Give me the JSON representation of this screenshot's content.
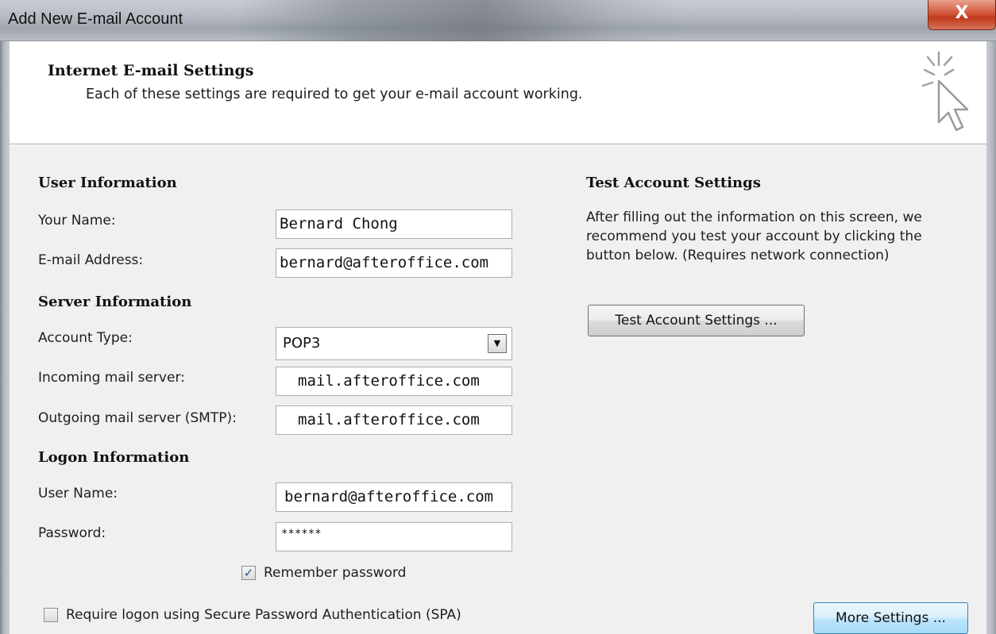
{
  "window": {
    "title": "Add New E-mail Account",
    "close_glyph": "X"
  },
  "header": {
    "title": "Internet E-mail Settings",
    "subtitle": "Each of these settings are required to get your e-mail account working.",
    "icon": "wizard-cursor-icon"
  },
  "user_info": {
    "heading": "User Information",
    "name_label": "Your Name:",
    "name_value": "Bernard Chong",
    "email_label": "E-mail Address:",
    "email_value": "bernard@afteroffice.com"
  },
  "server_info": {
    "heading": "Server Information",
    "account_type_label": "Account Type:",
    "account_type_value": "POP3",
    "incoming_label": "Incoming mail server:",
    "incoming_value": "mail.afteroffice.com",
    "outgoing_label": "Outgoing mail server (SMTP):",
    "outgoing_value": "mail.afteroffice.com"
  },
  "logon_info": {
    "heading": "Logon Information",
    "username_label": "User Name:",
    "username_value": "bernard@afteroffice.com",
    "password_label": "Password:",
    "password_value": "******",
    "remember_label": "Remember password",
    "remember_checked": true,
    "spa_label": "Require logon using Secure Password Authentication (SPA)",
    "spa_checked": false
  },
  "test_settings": {
    "heading": "Test Account Settings",
    "description": "After filling out the information on this screen, we recommend you test your account by clicking the button below. (Requires network connection)",
    "test_button": "Test Account Settings ...",
    "more_button": "More Settings ..."
  },
  "colors": {
    "content_bg": "#f0f0f0",
    "close_red": "#c0391b",
    "check_blue": "#2a4f8a"
  }
}
